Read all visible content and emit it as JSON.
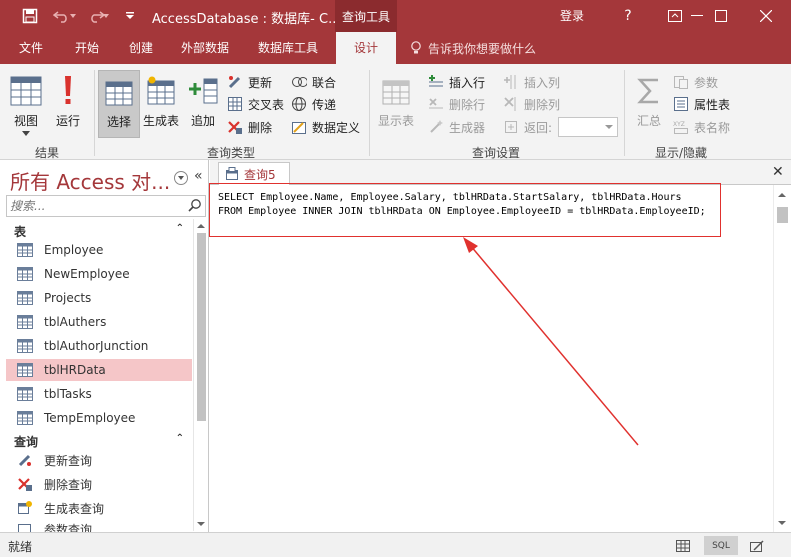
{
  "titlebar": {
    "app_title": "AccessDatabase : 数据库- C...",
    "context_title": "查询工具",
    "login": "登录",
    "help": "?"
  },
  "tabs": [
    "文件",
    "开始",
    "创建",
    "外部数据",
    "数据库工具",
    "设计"
  ],
  "tell_me": "告诉我你想要做什么",
  "ribbon": {
    "results": {
      "label": "结果",
      "view": "视图",
      "run": "运行"
    },
    "query_type": {
      "label": "查询类型",
      "select": "选择",
      "make_table": "生成表",
      "append": "追加",
      "update": "更新",
      "crosstab": "交叉表",
      "delete": "删除",
      "union": "联合",
      "pass_through": "传递",
      "data_definition": "数据定义"
    },
    "query_setup": {
      "label": "查询设置",
      "show_table": "显示表",
      "insert_rows": "插入行",
      "delete_rows": "删除行",
      "builder": "生成器",
      "insert_columns": "插入列",
      "delete_columns": "删除列",
      "return": "返回:"
    },
    "show_hide": {
      "label": "显示/隐藏",
      "totals": "汇总",
      "parameters": "参数",
      "property_sheet": "属性表",
      "table_names": "表名称"
    }
  },
  "nav": {
    "header": "所有 Access 对...",
    "search_placeholder": "搜索...",
    "categories": {
      "tables": "表",
      "queries": "查询"
    },
    "tables": [
      "Employee",
      "NewEmployee",
      "Projects",
      "tblAuthers",
      "tblAuthorJunction",
      "tblHRData",
      "tblTasks",
      "TempEmployee"
    ],
    "queries": [
      "更新查询",
      "删除查询",
      "生成表查询",
      "参数查询"
    ]
  },
  "document": {
    "tab_label": "查询5",
    "sql_line1": "SELECT Employee.Name, Employee.Salary, tblHRData.StartSalary, tblHRData.Hours",
    "sql_line2": "FROM Employee INNER JOIN tblHRData ON Employee.EmployeeID = tblHRData.EmployeeID;"
  },
  "status": {
    "text": "就绪",
    "sql_view": "SQL"
  },
  "colors": {
    "accent": "#a4373a",
    "annotation": "#e0312e"
  }
}
